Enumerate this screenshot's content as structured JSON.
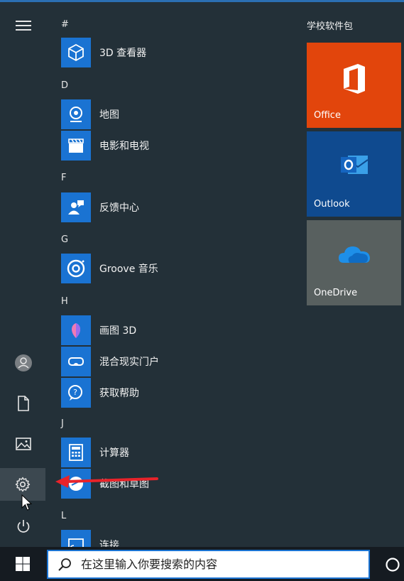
{
  "applist": {
    "groups": [
      {
        "header": "#",
        "items": [
          {
            "label": "3D 查看器",
            "icon": "cube-icon"
          }
        ]
      },
      {
        "header": "D",
        "items": [
          {
            "label": "地图",
            "icon": "map-pin-icon"
          },
          {
            "label": "电影和电视",
            "icon": "clapperboard-icon"
          }
        ]
      },
      {
        "header": "F",
        "items": [
          {
            "label": "反馈中心",
            "icon": "feedback-person-icon"
          }
        ]
      },
      {
        "header": "G",
        "items": [
          {
            "label": "Groove 音乐",
            "icon": "groove-disc-icon"
          }
        ]
      },
      {
        "header": "H",
        "items": [
          {
            "label": "画图 3D",
            "icon": "paint3d-icon"
          },
          {
            "label": "混合现实门户",
            "icon": "vr-headset-icon"
          },
          {
            "label": "获取帮助",
            "icon": "help-chat-icon"
          }
        ]
      },
      {
        "header": "J",
        "items": [
          {
            "label": "计算器",
            "icon": "calculator-icon"
          },
          {
            "label": "截图和草图",
            "icon": "snip-icon"
          }
        ]
      },
      {
        "header": "L",
        "items": [
          {
            "label": "连接",
            "icon": "connect-icon"
          }
        ]
      }
    ]
  },
  "tiles": {
    "header": "学校软件包",
    "items": [
      {
        "label": "Office",
        "icon": "office-icon",
        "color": "#e2450c"
      },
      {
        "label": "Outlook",
        "icon": "outlook-icon",
        "color": "#0f4a8f"
      },
      {
        "label": "OneDrive",
        "icon": "onedrive-cloud-icon",
        "color": "#58605f"
      }
    ]
  },
  "taskbar": {
    "search_placeholder": "在这里输入你要搜索的内容"
  },
  "colors": {
    "accent": "#1a73d2",
    "background": "#233038",
    "annotation_arrow": "#e8232a"
  }
}
